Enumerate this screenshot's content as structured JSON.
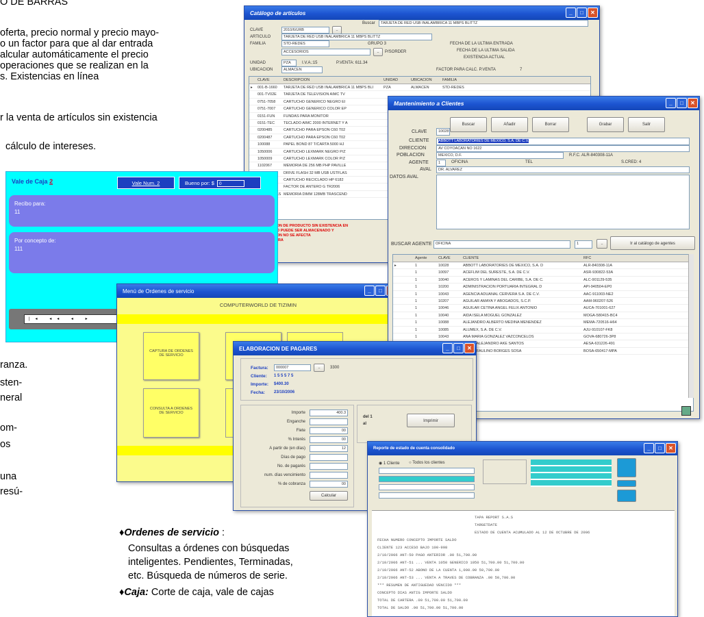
{
  "left_text": {
    "l1": "O DE BARRAS",
    "l2": "oferta, precio normal y precio mayo-",
    "l3": "o un factor para que al dar entrada",
    "l4": "alcular automáticamente el precio",
    "l5": "operaciones que se realizan en la",
    "l6": "s. Existencias en línea",
    "l7": "r la venta de artículos sin existencia",
    "l8": "cálculo de intereses.",
    "l9": "ranza.",
    "l10": "sten-",
    "l11": "neral",
    "l12": "om-",
    "l13": "os",
    "l14": "una",
    "l15": "resú-"
  },
  "bullets": {
    "b1_title": "Ordenes de servicio",
    "b1_colon": " :",
    "b1_l1": "Consultas a órdenes con búsquedas",
    "b1_l2": "inteligentes. Pendientes, Terminadas,",
    "b1_l3": "etc. Búsqueda de números de serie.",
    "b2_title": "Caja:",
    "b2_text": " Corte de caja, vale de cajas",
    "diamond": "♦"
  },
  "catalog": {
    "title": "Catálogo de artículos",
    "labels": {
      "clave": "CLAVE",
      "articulo": "ARTICULO",
      "familia": "FAMILIA",
      "unidad": "UNIDAD",
      "ubicacion": "UBICACION",
      "buscar": "Buscar"
    },
    "values": {
      "clave": "2010/6/URB",
      "articulo": "TARJETA DE RED USB INALAMBRICA 11 MBPS BLITTZ",
      "familia": "STD-REDES",
      "familia2": "ACCESORIOS",
      "unidad": "PZA",
      "ubicacion": "ALMACEN",
      "buscar_value": "TARJETA DE RED USB INALAMBRICA 11 MBPS BLITTZ",
      "iva": "I.V.A.:15",
      "pventa": "P.VENTA: 611.34",
      "piso": "P/SORDER",
      "grupo": "GRUPO 3"
    },
    "right_labels": {
      "r1": "FECHA DE LA ULTIMA ENTRADA",
      "r2": "FECHA DE LA ULTIMA SALIDA",
      "r3": "EXISTENCIA ACTUAL",
      "r4": "FACTOR PARA CALC. P.VENTA",
      "r4v": "7"
    },
    "grid_headers": [
      "CLAVE",
      "DESCRIPCION",
      "UNIDAD",
      "UBICACION",
      "FAMILIA"
    ],
    "rows": [
      [
        "001-B-1660",
        "TARJETA DE RED USB INALAMBRICA 11 MBPS BLI",
        "PZA",
        "ALMACEN",
        "STD-REDES"
      ],
      [
        "001-TV02E",
        "TARJETA DE TELEVISION AIMC TV",
        "",
        ""
      ],
      [
        "0751-7058",
        "CARTUCHO GENERICO NEGRO EI",
        "",
        ""
      ],
      [
        "0751-7007",
        "CARTUCHO GENERICO COLOR EP",
        "",
        ""
      ],
      [
        "0151-FUN",
        "FUNDAS PARA MONITOR",
        "",
        ""
      ],
      [
        "0151-TEC",
        "TECLADO AIMC 2000 INTERNET Y A",
        "",
        ""
      ],
      [
        "0200485",
        "CARTUCHO PARA EPSON C60 T02",
        "",
        ""
      ],
      [
        "0200487",
        "CARTUCHO PARA EPSON C60 T02",
        "",
        ""
      ],
      [
        "100088",
        "PAPEL BOND 87 T/CARTA 5000 HJ",
        "",
        ""
      ],
      [
        "1050006",
        "CARTUCHO LEXMARK NEGRO P/Z",
        "",
        ""
      ],
      [
        "1050009",
        "CARTUCHO LEXMARK COLOR P/Z",
        "",
        ""
      ],
      [
        "1102067",
        "MEMORIA DE 256 MB PHP PAVILLE",
        "",
        ""
      ],
      [
        "12345",
        "DRIVE FLASH 32 MB USB USTFLAS",
        "",
        ""
      ],
      [
        "1204580",
        "CARTUCHO RECICLADO HP 6182",
        "",
        ""
      ],
      [
        "1204885",
        "FACTOR DE ANTERO G TR2006",
        "",
        ""
      ],
      [
        "1204KBTRAS",
        "MEMORIA DIMM 128MB TRASCEND",
        "",
        ""
      ]
    ],
    "red_text": [
      "LA DESCRIPCION DE PRODUCTO SIN EXISTENCIA EN",
      "ESTE FORMATO PUEDE SER ALMACENADO Y",
      "LA DESCRIPCION NO SE AFECTA",
      "DE ESTA MANERA"
    ]
  },
  "clients": {
    "title": "Mantenimiento a Clientes",
    "buttons": [
      "Buscar",
      "Añadir",
      "Borrar",
      "Grabar",
      "Salir"
    ],
    "labels": {
      "clave": "CLAVE",
      "cliente": "CLIENTE",
      "direccion": "DIRECCION",
      "poblacion": "POBLACION",
      "agente": "AGENTE",
      "aval": "AVAL",
      "datos_aval": "DATOS AVAL",
      "buscar_agente": "BUSCAR AGENTE"
    },
    "values": {
      "clave": "10028",
      "cliente": "ABBOTT LABORATORIES DE MEXICO, S.A. DE C.V.",
      "direccion": "AV COYOACAN NO 1622",
      "poblacion": "MEXICO, D.F.",
      "rfc": "R.F.C. ALR-840308-11A",
      "agente": "1",
      "oficina": "OFICINA",
      "tel": "TEL",
      "scred": "S.CRED: 4",
      "aval": "DR. ALVAREZ",
      "buscar_agente_value": "OFICINA",
      "spin": "1",
      "go": "Ir al catálogo de agentes"
    },
    "grid_headers": [
      "Agente",
      "CLAVE",
      "CLIENTE",
      "RFC"
    ],
    "rows": [
      [
        "1",
        "10028",
        "ABBOTT LABORATORIES DE MEXICO, S.A. D",
        "ALR-840308-11A"
      ],
      [
        "1",
        "10097",
        "ACEFLIM DEL SURESTE, S.A. DE C.V.",
        "ASR-930822-53A"
      ],
      [
        "1",
        "10040",
        "ACEROS Y LAMINAS DEL CARIBE, S.A. DE C.",
        "ALC-901129-535"
      ],
      [
        "1",
        "10200",
        "ADMINISTRACION PORTUARIA INTEGRAL D",
        "API-940504-EP0"
      ],
      [
        "1",
        "10043",
        "AGENCIA ADUANAL CERVERA S.A. DE C.V.",
        "AAC-911003-NE2"
      ],
      [
        "1",
        "10207",
        "AGUILAR AMAYA Y ABOGADOS, S.C.P.",
        "AAM-960207-526"
      ],
      [
        "1",
        "10046",
        "AGUILAR CETINA ANGEL FELIX ANTONIO",
        "AUCA-701001-627"
      ],
      [
        "1",
        "10040",
        "AIDA ISELA MOGUEL GONZALEZ",
        "MOGA-580415-BC4"
      ],
      [
        "1",
        "10088",
        "ALEJANDRO ALBERTO MEDINA MENENDEZ",
        "MEMA-720516-H64"
      ],
      [
        "1",
        "10085",
        "ALUMEX, S.A. DE C.V.",
        "AJU-910107-FK8"
      ],
      [
        "1",
        "10043",
        "ANA MARIA GONZALEZ VAZCONCELOS",
        "GOVA-680726-3P8"
      ],
      [
        "1",
        "10106",
        "ANGEL ALEJANDRO AKE SANTOS",
        "AESA-631226-491"
      ],
      [
        "1",
        "10077",
        "ANGEL FAULINO BORGES SOSA",
        "BOSA-650417-MPA"
      ]
    ]
  },
  "caja": {
    "title": "Vale de Caja",
    "num": "2",
    "pill1": "Vale Num. 2",
    "pill2": "Bueno por: $",
    "pill2_val": "0",
    "recibo_label": "Recibo para:",
    "recibo_val": "11",
    "concepto_label": "Por concepto de:",
    "concepto_val": "111"
  },
  "ordenes": {
    "title": "Menú de Ordenes de servicio",
    "header": "COMPUTERWORLD DE TIZIMIN",
    "tile1": "CAPTURA DE ORDENES DE SERVICIO",
    "tile2": "CONSULTA A ORDENES DE SERVICIO"
  },
  "pagares": {
    "title": "ELABORACION DE PAGARES",
    "labels": {
      "factura": "Factura:",
      "cliente": "Cliente:",
      "importe": "Importe:",
      "fecha": "Fecha:"
    },
    "values": {
      "factura": "000007",
      "btn": "3300",
      "cliente": "1 5 5 5 7 5",
      "importe": "$400.30",
      "fecha": "23/10/2006"
    },
    "form": [
      [
        "Importe",
        "400.3"
      ],
      [
        "Enganche",
        ""
      ],
      [
        "Flete",
        "00"
      ],
      [
        "% Interés",
        "00"
      ],
      [
        "A partir de (en días)",
        "12"
      ],
      [
        "Días de pago",
        ""
      ],
      [
        "No. de pagarés",
        ""
      ],
      [
        "num. días vencimiento",
        ""
      ],
      [
        "% de cobranza",
        "00"
      ]
    ],
    "calc": "Calcular",
    "side1": "del 1",
    "side2": "al",
    "imprimir": "Imprimir"
  },
  "reporte": {
    "title": "Reporte de estado de cuenta consolidado",
    "radio1": "1 Cliente",
    "radio2": "Todos los clientes",
    "report_lines": [
      "TAPA REPORT S.A.S",
      "TARGETDATE",
      "ESTADO DE CUENTA ACUMULADO AL 12 DE OCTUBRE DE 2006",
      "FECHA    NUMERO          CONCEPTO                   IMPORTE    SALDO",
      "CLIENTE 123 ACCESO BAJO 100-998",
      "2/10/2006  ANT-50         PAGO ANTERIOR                     .00   51,700.00",
      "2/10/2006  ANT-51 ...     VENTA 1050 GENERICO 1050       51,700.00  51,700.00",
      "2/10/2006  ANT-52         ABONO DE LA CUENTA              1,000.00  50,700.00",
      "2/10/2006  ANT-53 ...     VENTA A TRAVES DE COBRANZA        .00    50,700.00",
      "*** RESUMEN DE ANTIGUEDAD VENCIDO ***",
      "      CONCEPTO         DIAS ANTIG   IMPORTE   SALDO",
      "      TOTAL DE CARTERA        .00   51,700.00  51,700.00",
      "      TOTAL DE SALDO          .00   51,700.00  51,700.00"
    ]
  },
  "colors": {
    "title_bar": "#1c54d0",
    "caja_bg": "#00ffff",
    "caja_panel": "#7b7bea",
    "ordenes_bg": "#fbfb8c",
    "ordenes_tile": "#ffff66",
    "highlight": "#2040c0"
  }
}
